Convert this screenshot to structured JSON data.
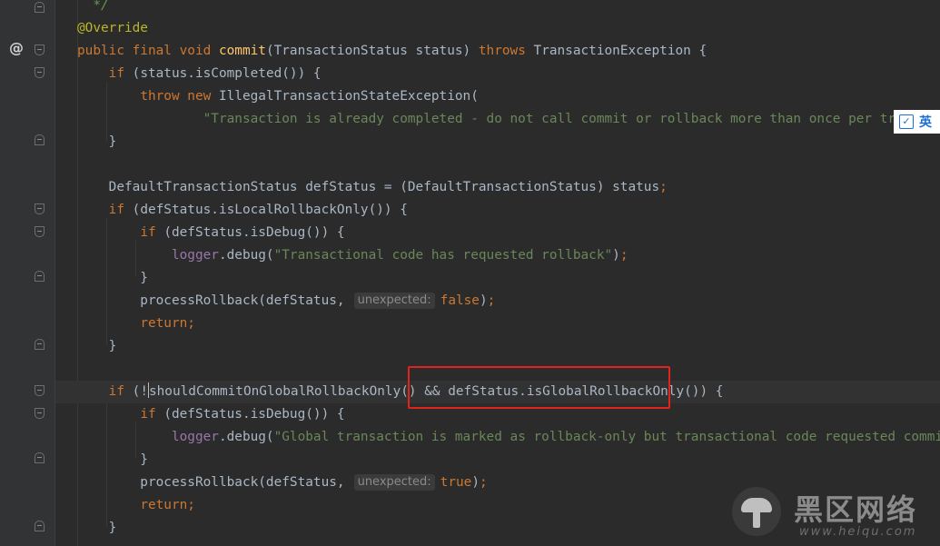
{
  "editor": {
    "lines": [
      {
        "parts": [
          {
            "t": "  */",
            "c": "cmt"
          }
        ]
      },
      {
        "parts": [
          {
            "t": "@Override",
            "c": "ann"
          }
        ]
      },
      {
        "parts": [
          {
            "t": "public final void ",
            "c": "kw"
          },
          {
            "t": "commit",
            "c": "fn"
          },
          {
            "t": "(TransactionStatus status) ",
            "c": ""
          },
          {
            "t": "throws ",
            "c": "kw"
          },
          {
            "t": "TransactionException {",
            "c": ""
          }
        ]
      },
      {
        "parts": [
          {
            "t": "    ",
            "c": ""
          },
          {
            "t": "if ",
            "c": "kw"
          },
          {
            "t": "(status.isCompleted()) {",
            "c": ""
          }
        ]
      },
      {
        "parts": [
          {
            "t": "        ",
            "c": ""
          },
          {
            "t": "throw new ",
            "c": "kw"
          },
          {
            "t": "IllegalTransactionStateException(",
            "c": ""
          }
        ]
      },
      {
        "parts": [
          {
            "t": "                ",
            "c": ""
          },
          {
            "t": "\"Transaction is already completed - do not call commit or rollback more than once per transaction\"",
            "c": "str"
          }
        ]
      },
      {
        "parts": [
          {
            "t": "    }",
            "c": ""
          }
        ]
      },
      {
        "parts": []
      },
      {
        "parts": [
          {
            "t": "    DefaultTransactionStatus defStatus = (DefaultTransactionStatus) status",
            "c": ""
          },
          {
            "t": ";",
            "c": "kw"
          }
        ]
      },
      {
        "parts": [
          {
            "t": "    ",
            "c": ""
          },
          {
            "t": "if ",
            "c": "kw"
          },
          {
            "t": "(defStatus.isLocalRollbackOnly()) {",
            "c": ""
          }
        ]
      },
      {
        "parts": [
          {
            "t": "        ",
            "c": ""
          },
          {
            "t": "if ",
            "c": "kw"
          },
          {
            "t": "(defStatus.isDebug()) {",
            "c": ""
          }
        ]
      },
      {
        "parts": [
          {
            "t": "            ",
            "c": ""
          },
          {
            "t": "logger",
            "c": "field"
          },
          {
            "t": ".debug(",
            "c": ""
          },
          {
            "t": "\"Transactional code has requested rollback\"",
            "c": "str"
          },
          {
            "t": ")",
            "c": ""
          },
          {
            "t": ";",
            "c": "kw"
          }
        ]
      },
      {
        "parts": [
          {
            "t": "        }",
            "c": ""
          }
        ]
      },
      {
        "parts": [
          {
            "t": "        processRollback(defStatus,",
            "c": ""
          },
          {
            "t": "unexpected:",
            "c": "hint"
          },
          {
            "t": "false",
            "c": "kw"
          },
          {
            "t": ")",
            "c": ""
          },
          {
            "t": ";",
            "c": "kw"
          }
        ]
      },
      {
        "parts": [
          {
            "t": "        ",
            "c": ""
          },
          {
            "t": "return;",
            "c": "kw"
          }
        ]
      },
      {
        "parts": [
          {
            "t": "    }",
            "c": ""
          }
        ]
      },
      {
        "parts": []
      },
      {
        "parts": [
          {
            "t": "    ",
            "c": ""
          },
          {
            "t": "if ",
            "c": "kw"
          },
          {
            "t": "(!",
            "c": ""
          },
          {
            "t": "",
            "c": "caret"
          },
          {
            "t": "shouldCommitOnGlobalRollbackOnly() && defStatus.isGlobalRollbackOnly()) {",
            "c": ""
          }
        ],
        "current": true
      },
      {
        "parts": [
          {
            "t": "        ",
            "c": ""
          },
          {
            "t": "if ",
            "c": "kw"
          },
          {
            "t": "(defStatus.isDebug()) {",
            "c": ""
          }
        ]
      },
      {
        "parts": [
          {
            "t": "            ",
            "c": ""
          },
          {
            "t": "logger",
            "c": "field"
          },
          {
            "t": ".debug(",
            "c": ""
          },
          {
            "t": "\"Global transaction is marked as rollback-only but transactional code requested commit\"",
            "c": "str"
          },
          {
            "t": ")",
            "c": ""
          },
          {
            "t": ";",
            "c": "kw"
          }
        ]
      },
      {
        "parts": [
          {
            "t": "        }",
            "c": ""
          }
        ]
      },
      {
        "parts": [
          {
            "t": "        processRollback(defStatus,",
            "c": ""
          },
          {
            "t": "unexpected:",
            "c": "hint"
          },
          {
            "t": "true",
            "c": "kw"
          },
          {
            "t": ")",
            "c": ""
          },
          {
            "t": ";",
            "c": "kw"
          }
        ]
      },
      {
        "parts": [
          {
            "t": "        ",
            "c": ""
          },
          {
            "t": "return;",
            "c": "kw"
          }
        ]
      },
      {
        "parts": [
          {
            "t": "    }",
            "c": ""
          }
        ]
      }
    ]
  },
  "gutter": {
    "override_marker": "@"
  },
  "ime_indicator": {
    "icon": "checkbox-icon",
    "label": "英"
  },
  "watermark": {
    "logo": "mushroom-logo",
    "title": "黑区网络",
    "url": "www.heiqu.com"
  }
}
